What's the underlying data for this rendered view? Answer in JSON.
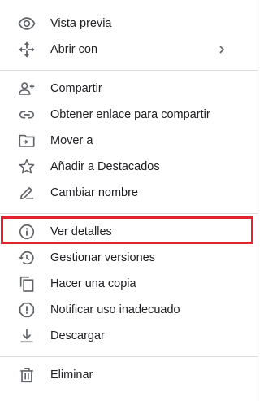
{
  "menu": {
    "items": [
      {
        "label": "Vista previa",
        "icon": "eye-icon"
      },
      {
        "label": "Abrir con",
        "icon": "move-arrows-icon",
        "has_submenu": true
      },
      {
        "label": "Compartir",
        "icon": "person-add-icon"
      },
      {
        "label": "Obtener enlace para compartir",
        "icon": "link-icon"
      },
      {
        "label": "Mover a",
        "icon": "folder-move-icon"
      },
      {
        "label": "Añadir a Destacados",
        "icon": "star-outline-icon"
      },
      {
        "label": "Cambiar nombre",
        "icon": "pencil-icon"
      },
      {
        "label": "Ver detalles",
        "icon": "info-icon",
        "highlighted": true
      },
      {
        "label": "Gestionar versiones",
        "icon": "history-icon"
      },
      {
        "label": "Hacer una copia",
        "icon": "copy-icon"
      },
      {
        "label": "Notificar uso inadecuado",
        "icon": "report-icon"
      },
      {
        "label": "Descargar",
        "icon": "download-icon"
      },
      {
        "label": "Eliminar",
        "icon": "trash-icon"
      }
    ]
  },
  "colors": {
    "icon": "#5f6368",
    "text": "#202124",
    "divider": "#dadce0",
    "highlight": "#e0232e"
  }
}
